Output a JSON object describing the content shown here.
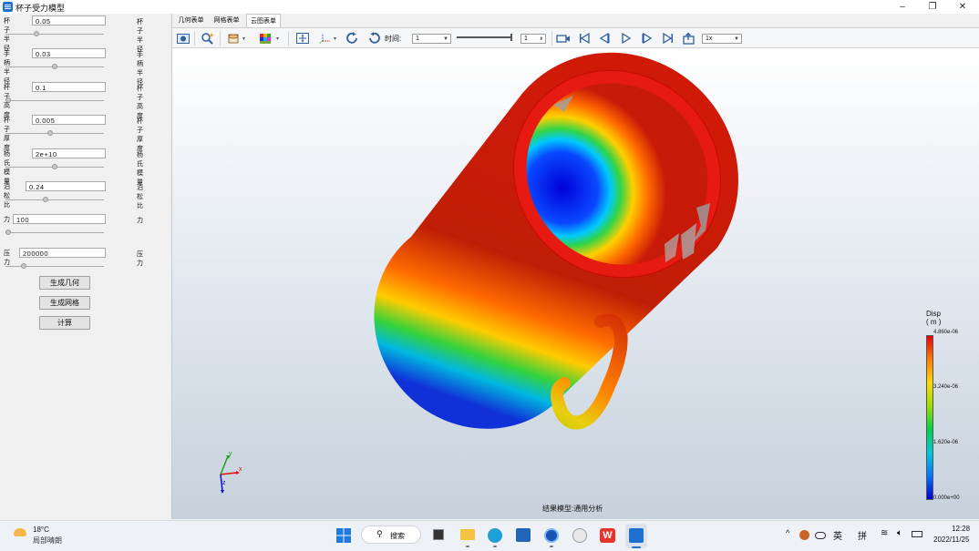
{
  "window": {
    "title": "杯子受力模型",
    "min_glyph": "–",
    "max_glyph": "❐",
    "close_glyph": "✕"
  },
  "params": [
    {
      "label": "杯子半径",
      "value": "0.05",
      "right_label": "杯子半径",
      "slider": 0.3
    },
    {
      "label": "手柄半径",
      "value": "0.03",
      "right_label": "手柄半径",
      "slider": 0.5
    },
    {
      "label": "杯子高度",
      "value": "0.1",
      "right_label": "杯子高度",
      "slider": 0.0
    },
    {
      "label": "杯子厚度",
      "value": "0.005",
      "right_label": "杯子厚度",
      "slider": 0.45
    },
    {
      "label": "杨氏模量",
      "value": "2e+10",
      "right_label": "杨氏模量",
      "slider": 0.5
    },
    {
      "label": "泊松比",
      "value": "0.24",
      "right_label": "泊松比",
      "slider": 0.4
    },
    {
      "label": "力",
      "value": "100",
      "right_label": "力",
      "slider": 0.0
    },
    {
      "label": "压力",
      "value": "200000",
      "right_label": "压力",
      "slider": 0.17
    }
  ],
  "buttons": {
    "geometry": "生成几何",
    "mesh": "生成网格",
    "compute": "计算"
  },
  "tabs": [
    {
      "label": "几何表单"
    },
    {
      "label": "网格表单"
    },
    {
      "label": "云图表单"
    }
  ],
  "active_tab": 2,
  "toolbar": {
    "time_label": "时间:",
    "time_select": "1",
    "step_value": "1",
    "speed_select": "1x"
  },
  "legend": {
    "title": "Disp",
    "unit": "( m )",
    "ticks": [
      "4.860e-06",
      "3.240e-06",
      "1.620e-06",
      "0.000e+00"
    ],
    "colors": [
      "#e8000b",
      "#ff7a00",
      "#ffd800",
      "#9be000",
      "#00d24a",
      "#00c8d8",
      "#0078ff",
      "#0000d4"
    ]
  },
  "axes": {
    "x": "x",
    "y": "y",
    "z": "z"
  },
  "caption": "结果模型:通用分析",
  "taskbar": {
    "temp": "18°C",
    "weather": "局部晴朗",
    "search": "搜索",
    "lang": "英",
    "ime": "拼",
    "time": "12:28",
    "date": "2022/11/25",
    "caret": "^"
  }
}
